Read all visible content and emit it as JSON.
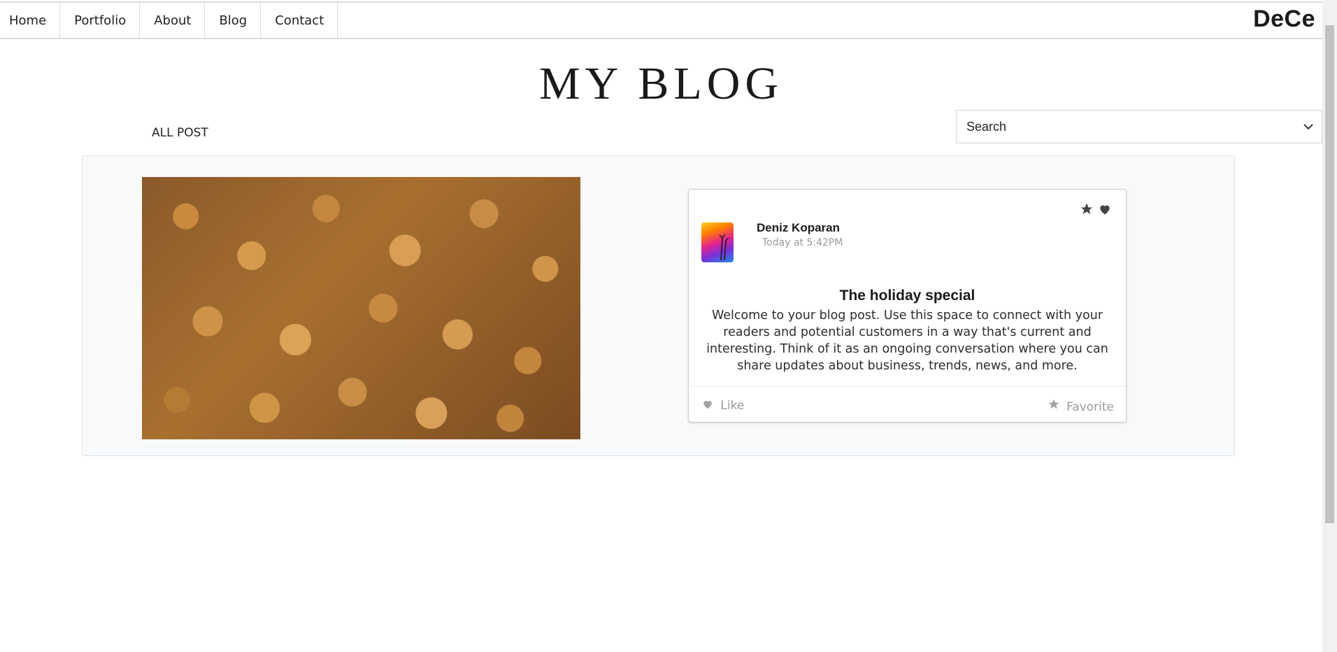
{
  "nav": {
    "items": [
      "Home",
      "Portfolio",
      "About",
      "Blog",
      "Contact"
    ],
    "brand": "DeCe"
  },
  "page": {
    "title": "MY BLOG",
    "filter_label": "ALL POST",
    "search": {
      "value": "Search"
    }
  },
  "post": {
    "image_subject": "walnuts photo",
    "author": "Deniz Koparan",
    "timestamp": "Today at 5:42PM",
    "title": "The holiday special",
    "body": "Welcome to your blog post. Use this space to connect with your readers and potential customers in a way that's current and interesting. Think of it as an ongoing conversation where you can share updates about business, trends, news, and more.",
    "like_label": "Like",
    "favorite_label": "Favorite",
    "icons": {
      "star": "star-icon",
      "heart": "heart-icon"
    }
  }
}
